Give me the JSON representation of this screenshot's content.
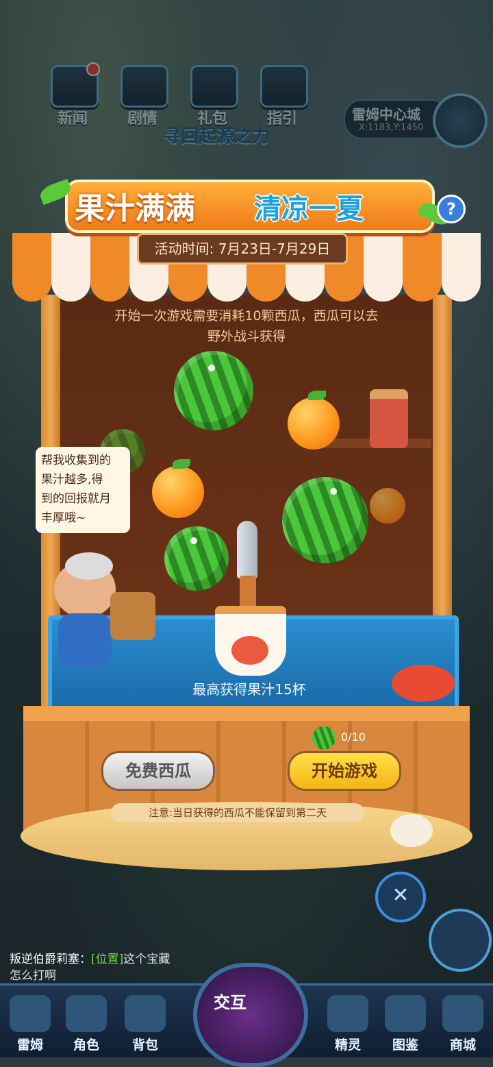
{
  "top_nav": [
    {
      "label": "新闻",
      "icon": "news-icon",
      "dot": true
    },
    {
      "label": "剧情",
      "icon": "story-icon",
      "dot": false
    },
    {
      "label": "礼包",
      "icon": "gift-icon",
      "dot": false
    },
    {
      "label": "指引",
      "icon": "guide-icon",
      "dot": false
    }
  ],
  "location": {
    "name": "雷姆中心城",
    "coords": "X:1183,Y:1450"
  },
  "subtitle": "寻回起源之力",
  "event": {
    "title_part1": "果汁满满",
    "title_part2": "清凉一夏",
    "help": "?",
    "date_label": "活动时间: 7月23日-7月29日",
    "info_line1": "开始一次游戏需要消耗10颗西瓜，西瓜可以去",
    "info_line2": "野外战斗获得",
    "max_juice": "最高获得果汁15杯",
    "watermelon_count": "0/10",
    "free_button": "免费西瓜",
    "start_button": "开始游戏",
    "note": "注意:当日获得的西瓜不能保留到第二天"
  },
  "bubble": {
    "line1": "帮我收集到的",
    "line2": "果汁越多,得",
    "line3": "到的回报就月",
    "line4": "丰厚哦~"
  },
  "close_icon": "close-icon",
  "chat": {
    "name": "叛逆伯爵莉塞：",
    "tag": "[位置]",
    "text": "这个宝藏",
    "text2": "怎么打啊"
  },
  "bottom_nav": [
    {
      "label": "雷姆",
      "icon": "leimu-icon"
    },
    {
      "label": "角色",
      "icon": "role-icon"
    },
    {
      "label": "背包",
      "icon": "bag-icon"
    },
    {
      "label": "精灵",
      "icon": "spirit-icon"
    },
    {
      "label": "图鉴",
      "icon": "atlas-icon"
    },
    {
      "label": "商城",
      "icon": "shop-icon"
    }
  ],
  "center_button": "交互",
  "colors": {
    "orange": "#f07a1a",
    "blue": "#22a0d8",
    "start_yellow": "#f4b512"
  }
}
